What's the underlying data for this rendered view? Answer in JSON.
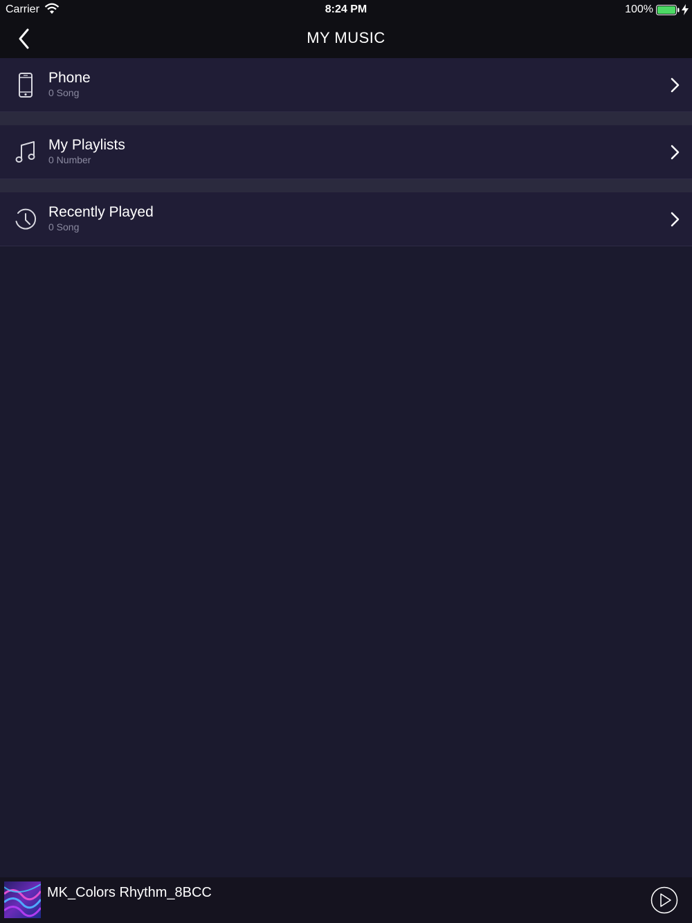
{
  "status_bar": {
    "carrier": "Carrier",
    "time": "8:24 PM",
    "battery_percent": "100%",
    "battery_level": 1.0,
    "icons": [
      "wifi-icon",
      "battery-icon",
      "charging-bolt-icon"
    ]
  },
  "nav": {
    "title": "MY MUSIC",
    "back_icon": "chevron-left-icon"
  },
  "menu": {
    "items": [
      {
        "label": "Phone",
        "sub": "0 Song",
        "icon": "phone-icon"
      },
      {
        "label": "My Playlists",
        "sub": "0 Number",
        "icon": "music-note-icon"
      },
      {
        "label": "Recently Played",
        "sub": "0 Song",
        "icon": "clock-icon"
      }
    ]
  },
  "player": {
    "song_title": "MK_Colors Rhythm_8BCC",
    "play_icon": "play-icon"
  },
  "colors": {
    "background": "#1b1a2e",
    "row_background": "#201d36",
    "header_background": "#0f0f14",
    "subtext": "#8b8aa0",
    "battery_green": "#4cd964"
  }
}
